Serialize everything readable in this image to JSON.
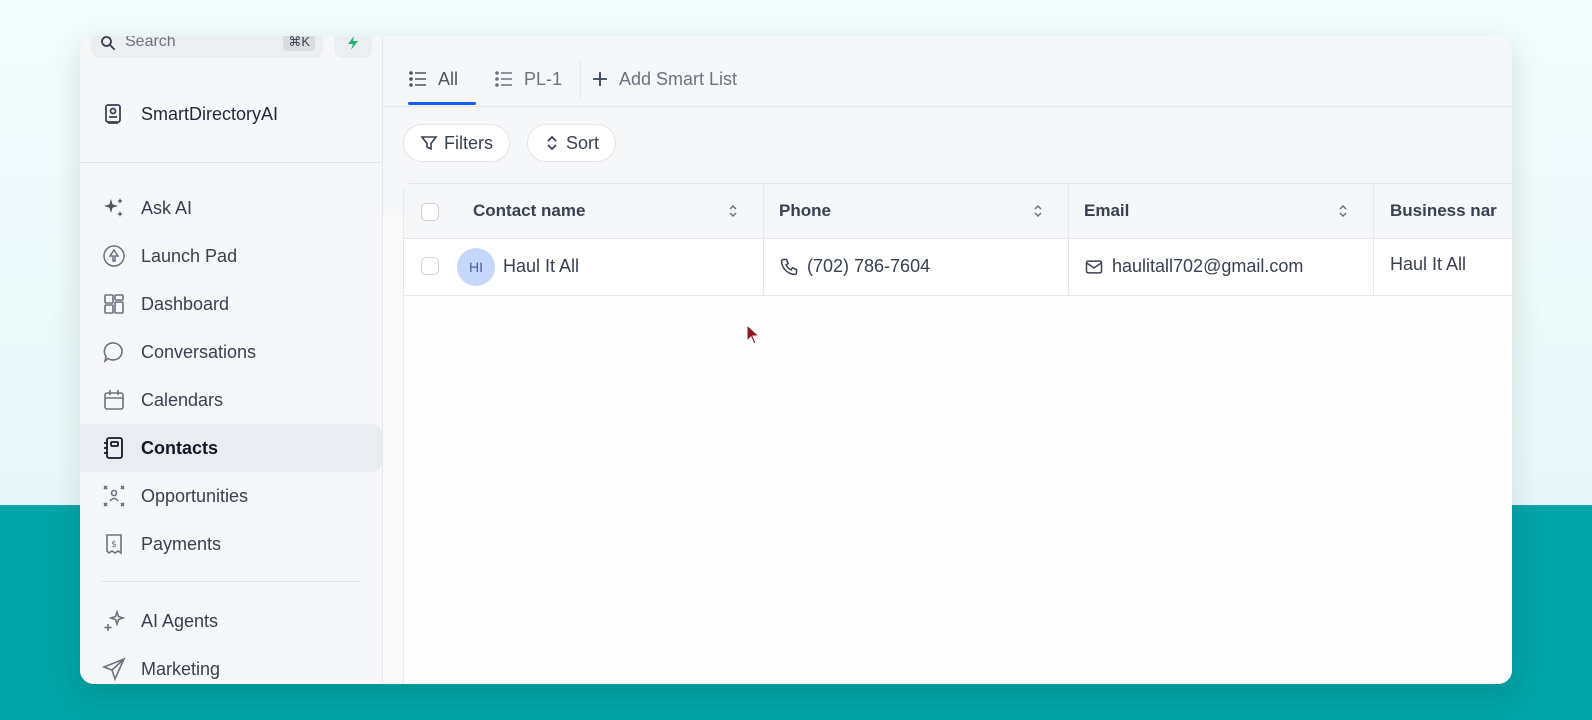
{
  "sidebar": {
    "search_placeholder": "Search",
    "shortcut": "⌘K",
    "account_name": "SmartDirectoryAI",
    "items": [
      {
        "label": "Ask AI",
        "icon": "sparkles-icon"
      },
      {
        "label": "Launch Pad",
        "icon": "rocket-icon"
      },
      {
        "label": "Dashboard",
        "icon": "dashboard-icon"
      },
      {
        "label": "Conversations",
        "icon": "chat-bubble-icon"
      },
      {
        "label": "Calendars",
        "icon": "calendar-icon"
      },
      {
        "label": "Contacts",
        "icon": "contact-book-icon",
        "active": true
      },
      {
        "label": "Opportunities",
        "icon": "opportunities-icon"
      },
      {
        "label": "Payments",
        "icon": "payments-icon"
      }
    ],
    "items2": [
      {
        "label": "AI Agents",
        "icon": "ai-agents-icon"
      },
      {
        "label": "Marketing",
        "icon": "paper-plane-icon"
      }
    ]
  },
  "tabs": {
    "all": "All",
    "pl1": "PL-1",
    "add": "Add Smart List"
  },
  "toolbar": {
    "filters": "Filters",
    "sort": "Sort"
  },
  "table": {
    "columns": [
      "Contact name",
      "Phone",
      "Email",
      "Business nar"
    ],
    "rows": [
      {
        "initials": "HI",
        "name": "Haul It All",
        "phone": "(702) 786-7604",
        "email": "haulitall702@gmail.com",
        "business": "Haul It All"
      }
    ]
  },
  "colors": {
    "accent": "#155eef",
    "teal_background": "#03a4a7",
    "avatar_bg": "#c7d7fb"
  }
}
